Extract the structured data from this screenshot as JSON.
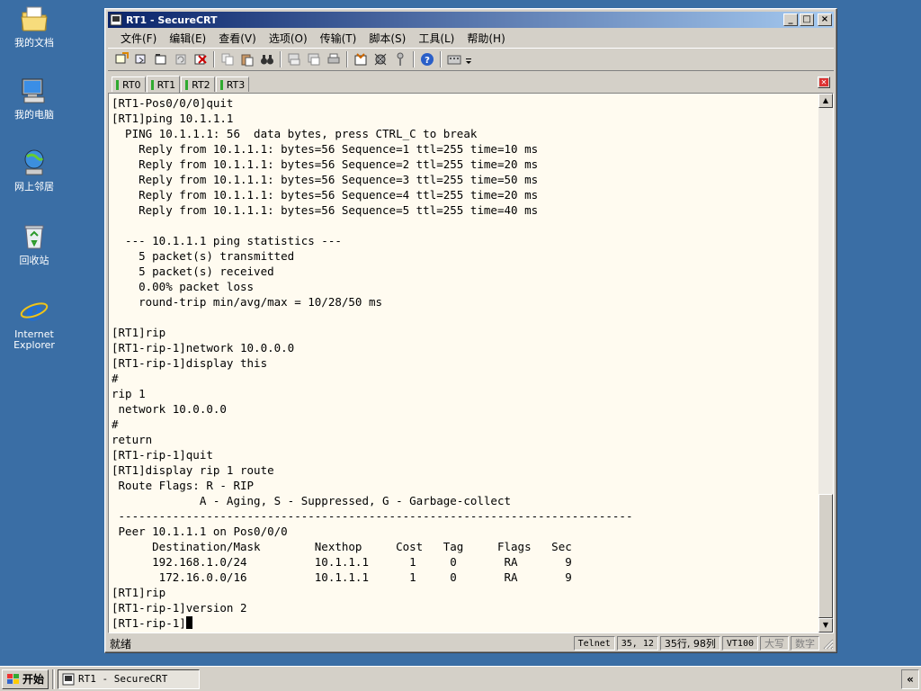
{
  "desktop": {
    "icons": [
      {
        "label": "我的文档"
      },
      {
        "label": "我的电脑"
      },
      {
        "label": "网上邻居"
      },
      {
        "label": "回收站"
      },
      {
        "label": "Internet Explorer"
      }
    ]
  },
  "window": {
    "title": "RT1 - SecureCRT",
    "controls": {
      "minimize": "_",
      "maximize": "□",
      "close": "×"
    }
  },
  "menu": [
    {
      "label": "文件(F)"
    },
    {
      "label": "编辑(E)"
    },
    {
      "label": "查看(V)"
    },
    {
      "label": "选项(O)"
    },
    {
      "label": "传输(T)"
    },
    {
      "label": "脚本(S)"
    },
    {
      "label": "工具(L)"
    },
    {
      "label": "帮助(H)"
    }
  ],
  "tabs": [
    {
      "label": "RT0",
      "active": false
    },
    {
      "label": "RT1",
      "active": true
    },
    {
      "label": "RT2",
      "active": false
    },
    {
      "label": "RT3",
      "active": false
    }
  ],
  "terminal": {
    "lines": [
      "[RT1-Pos0/0/0]quit",
      "[RT1]ping 10.1.1.1",
      "  PING 10.1.1.1: 56  data bytes, press CTRL_C to break",
      "    Reply from 10.1.1.1: bytes=56 Sequence=1 ttl=255 time=10 ms",
      "    Reply from 10.1.1.1: bytes=56 Sequence=2 ttl=255 time=20 ms",
      "    Reply from 10.1.1.1: bytes=56 Sequence=3 ttl=255 time=50 ms",
      "    Reply from 10.1.1.1: bytes=56 Sequence=4 ttl=255 time=20 ms",
      "    Reply from 10.1.1.1: bytes=56 Sequence=5 ttl=255 time=40 ms",
      "",
      "  --- 10.1.1.1 ping statistics ---",
      "    5 packet(s) transmitted",
      "    5 packet(s) received",
      "    0.00% packet loss",
      "    round-trip min/avg/max = 10/28/50 ms",
      "",
      "[RT1]rip",
      "[RT1-rip-1]network 10.0.0.0",
      "[RT1-rip-1]display this",
      "#",
      "rip 1",
      " network 10.0.0.0",
      "#",
      "return",
      "[RT1-rip-1]quit",
      "[RT1]display rip 1 route",
      " Route Flags: R - RIP",
      "             A - Aging, S - Suppressed, G - Garbage-collect",
      " ----------------------------------------------------------------------------",
      " Peer 10.1.1.1 on Pos0/0/0",
      "      Destination/Mask        Nexthop     Cost   Tag     Flags   Sec",
      "      192.168.1.0/24          10.1.1.1      1     0       RA       9",
      "       172.16.0.0/16          10.1.1.1      1     0       RA       9",
      "[RT1]rip",
      "[RT1-rip-1]version 2"
    ],
    "prompt": "[RT1-rip-1]"
  },
  "status": {
    "main": "就绪",
    "protocol": "Telnet",
    "cursor_pos": "35,  12",
    "size": "35行, 98列",
    "emulation": "VT100",
    "caps": "大写",
    "num": "数字"
  },
  "taskbar": {
    "start_label": "开始",
    "task_label": "RT1 - SecureCRT",
    "tray_label": "«"
  }
}
